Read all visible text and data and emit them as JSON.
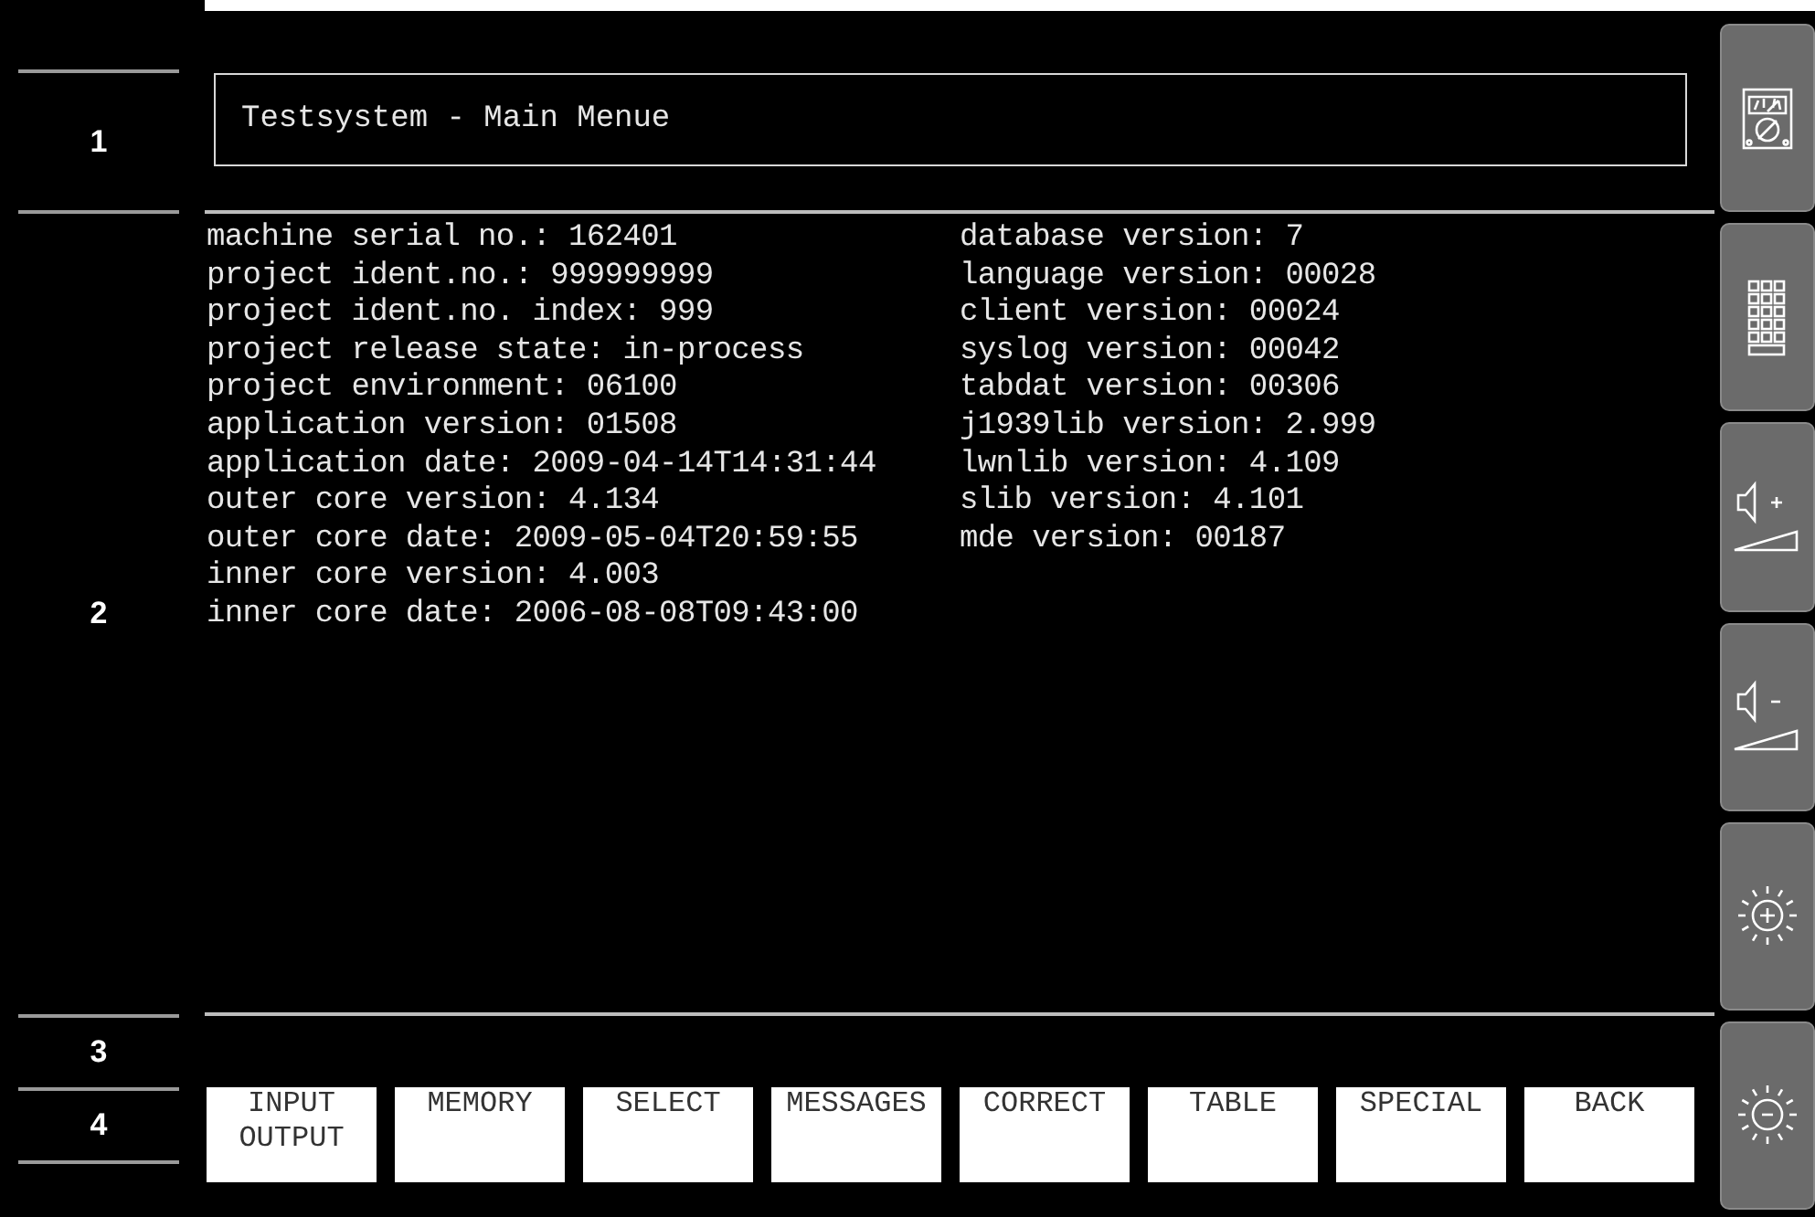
{
  "row_labels": [
    "1",
    "2",
    "3",
    "4"
  ],
  "title": "Testsystem - Main Menue",
  "info_left": [
    "machine serial no.: 162401",
    "project ident.no.: 999999999",
    "project ident.no. index: 999",
    "project release state: in-process",
    "project environment: 06100",
    "application version: 01508",
    "application date: 2009-04-14T14:31:44",
    "outer core version: 4.134",
    "outer core date: 2009-05-04T20:59:55",
    "inner core version: 4.003",
    "inner core date: 2006-08-08T09:43:00"
  ],
  "info_right": [
    "database version: 7",
    "language version: 00028",
    "client version: 00024",
    "syslog version: 00042",
    "tabdat version: 00306",
    "j1939lib version: 2.999",
    "lwnlib version: 4.109",
    "slib version: 4.101",
    "mde version: 00187"
  ],
  "softkeys": [
    [
      "INPUT",
      "OUTPUT"
    ],
    [
      "MEMORY"
    ],
    [
      "SELECT"
    ],
    [
      "MESSAGES"
    ],
    [
      "CORRECT"
    ],
    [
      "TABLE"
    ],
    [
      "SPECIAL"
    ],
    [
      "BACK"
    ]
  ],
  "side_buttons": [
    {
      "kind": "meter"
    },
    {
      "kind": "keypad"
    },
    {
      "kind": "volume_up"
    },
    {
      "kind": "volume_down"
    },
    {
      "kind": "brightness_up"
    },
    {
      "kind": "brightness_down"
    }
  ]
}
